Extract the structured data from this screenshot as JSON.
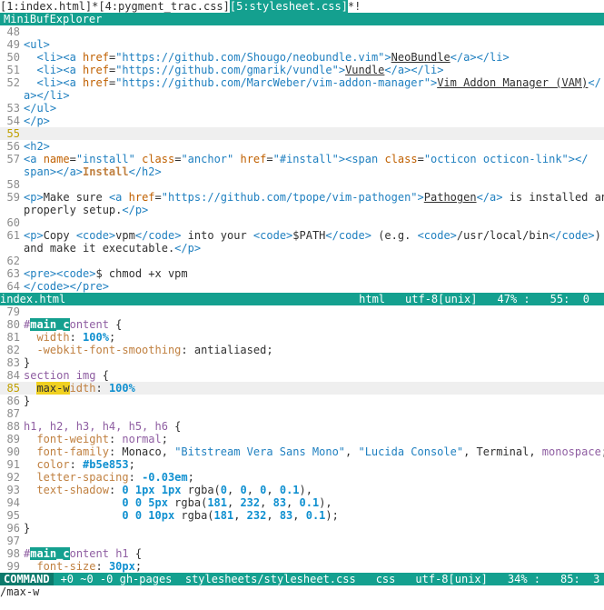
{
  "buffers": {
    "b1": "[1:index.html]*",
    "b2": "[4:pygment_trac.css]",
    "b3": "[5:stylesheet.css]",
    "b3_suffix": "*!"
  },
  "minibuf_title": "MiniBufExplorer",
  "html_pane": {
    "lines": [
      {
        "n": "48",
        "t": ""
      },
      {
        "n": "49",
        "t": "<ul>"
      },
      {
        "n": "50",
        "t": "  <li><a href=\"https://github.com/Shougo/neobundle.vim\">NeoBundle</a></li>"
      },
      {
        "n": "51",
        "t": "  <li><a href=\"https://github.com/gmarik/vundle\">Vundle</a></li>"
      },
      {
        "n": "52",
        "t": "  <li><a href=\"https://github.com/MarcWeber/vim-addon-manager\">Vim Addon Manager (VAM)</"
      },
      {
        "n": "",
        "t": "a></li>"
      },
      {
        "n": "53",
        "t": "</ul>"
      },
      {
        "n": "54",
        "t": "</p>"
      },
      {
        "n": "55",
        "t": ""
      },
      {
        "n": "56",
        "t": "<h2>"
      },
      {
        "n": "57",
        "t": "<a name=\"install\" class=\"anchor\" href=\"#install\"><span class=\"octicon octicon-link\"></"
      },
      {
        "n": "",
        "t": "span></a>Install</h2>"
      },
      {
        "n": "58",
        "t": ""
      },
      {
        "n": "59",
        "t": "<p>Make sure <a href=\"https://github.com/tpope/vim-pathogen\">Pathogen</a> is installed and"
      },
      {
        "n": "",
        "t": "properly setup.</p>"
      },
      {
        "n": "60",
        "t": ""
      },
      {
        "n": "61",
        "t": "<p>Copy <code>vpm</code> into your <code>$PATH</code> (e.g. <code>/usr/local/bin</code>)"
      },
      {
        "n": "",
        "t": "and make it executable.</p>"
      },
      {
        "n": "62",
        "t": ""
      },
      {
        "n": "63",
        "t": "<pre><code>$ chmod +x vpm"
      },
      {
        "n": "64",
        "t": "</code></pre>"
      }
    ],
    "status": {
      "file": "index.html",
      "type": "html",
      "enc": "utf-8[unix]",
      "pct": "47% :",
      "pos": "55:  0"
    }
  },
  "css_pane": {
    "lines": [
      {
        "n": "79",
        "t": ""
      },
      {
        "n": "80",
        "t": "#main_content {"
      },
      {
        "n": "81",
        "t": "  width: 100%;"
      },
      {
        "n": "82",
        "t": "  -webkit-font-smoothing: antialiased;"
      },
      {
        "n": "83",
        "t": "}"
      },
      {
        "n": "84",
        "t": "section img {"
      },
      {
        "n": "85",
        "t": "  max-width: 100%"
      },
      {
        "n": "86",
        "t": "}"
      },
      {
        "n": "87",
        "t": ""
      },
      {
        "n": "88",
        "t": "h1, h2, h3, h4, h5, h6 {"
      },
      {
        "n": "89",
        "t": "  font-weight: normal;"
      },
      {
        "n": "90",
        "t": "  font-family: Monaco, \"Bitstream Vera Sans Mono\", \"Lucida Console\", Terminal, monospace;"
      },
      {
        "n": "91",
        "t": "  color: #b5e853;"
      },
      {
        "n": "92",
        "t": "  letter-spacing: -0.03em;"
      },
      {
        "n": "93",
        "t": "  text-shadow: 0 1px 1px rgba(0, 0, 0, 0.1),"
      },
      {
        "n": "94",
        "t": "               0 0 5px rgba(181, 232, 83, 0.1),"
      },
      {
        "n": "95",
        "t": "               0 0 10px rgba(181, 232, 83, 0.1);"
      },
      {
        "n": "96",
        "t": "}"
      },
      {
        "n": "97",
        "t": ""
      },
      {
        "n": "98",
        "t": "#main_content h1 {"
      },
      {
        "n": "99",
        "t": "  font-size: 30px;"
      }
    ],
    "status": {
      "mode": "COMMAND",
      "git": "+0 ~0 -0 gh-pages",
      "file": "stylesheets/stylesheet.css",
      "type": "css",
      "enc": "utf-8[unix]",
      "pct": "34% :",
      "pos": "85:  3"
    }
  },
  "cmdline": "/max-w",
  "colors": {
    "accent": "#14a08f",
    "search_hl": "#14a08f",
    "cursor_hl": "#f0d020"
  }
}
